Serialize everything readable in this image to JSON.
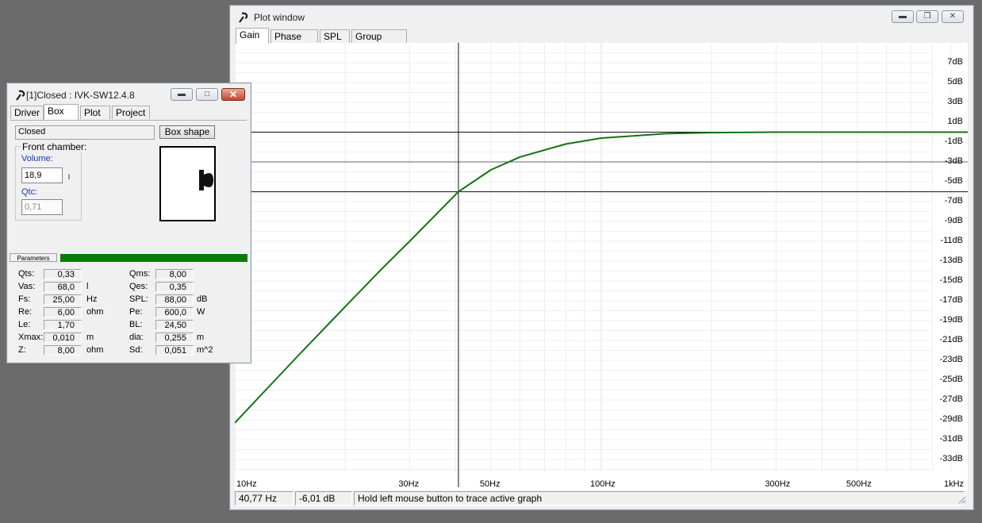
{
  "plot_window": {
    "title": "Plot window",
    "tabs": [
      "Gain",
      "Phase plot",
      "SPL",
      "Group delay"
    ],
    "active_tab": "Gain",
    "status": {
      "frequency": "40,77 Hz",
      "gain": "-6,01 dB",
      "hint": "Hold left mouse button to trace active graph"
    },
    "cursor": {
      "frequency_hz": 40.77,
      "gain_db": -6.01
    }
  },
  "chart_data": {
    "type": "line",
    "title": "",
    "xlabel": "",
    "ylabel": "",
    "x_scale": "log",
    "xlim": [
      10,
      1000
    ],
    "ylim": [
      -34,
      8
    ],
    "x_ticks": [
      "10Hz",
      "30Hz",
      "50Hz",
      "100Hz",
      "300Hz",
      "500Hz",
      "1kHz"
    ],
    "x_tick_values": [
      10,
      30,
      50,
      100,
      300,
      500,
      1000
    ],
    "y_ticks": [
      "7dB",
      "5dB",
      "3dB",
      "1dB",
      "-1dB",
      "-3dB",
      "-5dB",
      "-7dB",
      "-9dB",
      "-11dB",
      "-13dB",
      "-15dB",
      "-17dB",
      "-19dB",
      "-21dB",
      "-23dB",
      "-25dB",
      "-27dB",
      "-29dB",
      "-31dB",
      "-33dB"
    ],
    "y_tick_values": [
      7,
      5,
      3,
      1,
      -1,
      -3,
      -5,
      -7,
      -9,
      -11,
      -13,
      -15,
      -17,
      -19,
      -21,
      -23,
      -25,
      -27,
      -29,
      -31,
      -33
    ],
    "reference_lines_db": [
      0,
      -3,
      -6.01
    ],
    "series": [
      {
        "color": "#157315",
        "x": [
          10,
          15,
          20,
          25,
          30,
          40.77,
          50,
          60,
          80,
          100,
          150,
          200,
          300,
          500,
          1000
        ],
        "y": [
          -29.3,
          -22.4,
          -17.6,
          -13.9,
          -11.0,
          -6.0,
          -3.8,
          -2.5,
          -1.2,
          -0.6,
          -0.15,
          -0.05,
          0,
          0,
          0
        ]
      }
    ]
  },
  "driver_window": {
    "title": "[1]Closed : IVK-SW12.4.8",
    "tabs": [
      "Driver",
      "Box",
      "Plot",
      "Project"
    ],
    "active_tab": "Box",
    "box_type": "Closed",
    "box_shape_button": "Box shape",
    "front_chamber_label": "Front chamber:",
    "volume_label": "Volume:",
    "volume_value": "18,9",
    "volume_unit": "l",
    "qtc_label": "Qtc:",
    "qtc_value": "0,71",
    "parameters_label": "Parameters",
    "parameters_left": [
      {
        "label": "Qts:",
        "value": "0,33",
        "unit": ""
      },
      {
        "label": "Vas:",
        "value": "68,0",
        "unit": "l"
      },
      {
        "label": "Fs:",
        "value": "25,00",
        "unit": "Hz"
      },
      {
        "label": "Re:",
        "value": "6,00",
        "unit": "ohm"
      },
      {
        "label": "Le:",
        "value": "1,70",
        "unit": ""
      },
      {
        "label": "Xmax:",
        "value": "0,010",
        "unit": "m"
      },
      {
        "label": "Z:",
        "value": "8,00",
        "unit": "ohm"
      }
    ],
    "parameters_right": [
      {
        "label": "Qms:",
        "value": "8,00",
        "unit": ""
      },
      {
        "label": "Qes:",
        "value": "0,35",
        "unit": ""
      },
      {
        "label": "SPL:",
        "value": "88,00",
        "unit": "dB"
      },
      {
        "label": "Pe:",
        "value": "600,0",
        "unit": "W"
      },
      {
        "label": "BL:",
        "value": "24,50",
        "unit": ""
      },
      {
        "label": "dia:",
        "value": "0,255",
        "unit": "m"
      },
      {
        "label": "Sd:",
        "value": "0,051",
        "unit": "m^2"
      }
    ]
  },
  "colors": {
    "curve": "#157315",
    "progress": "#0b7a0b",
    "desktop": "#6b6b6b"
  }
}
